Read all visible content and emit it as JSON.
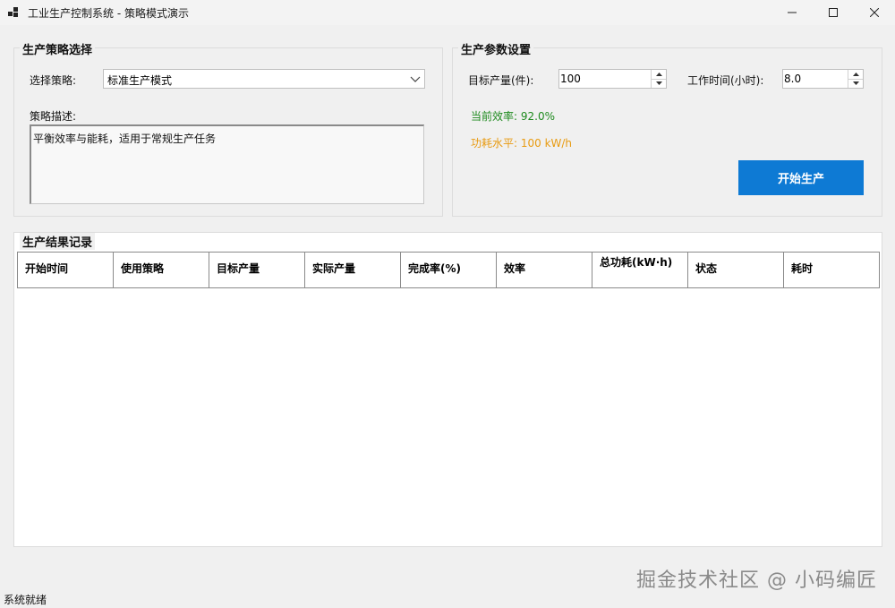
{
  "window": {
    "title": "工业生产控制系统 - 策略模式演示"
  },
  "strategy_group": {
    "title": "生产策略选择",
    "select_label": "选择策略:",
    "selected_strategy": "标准生产模式",
    "description_label": "策略描述:",
    "description": "平衡效率与能耗，适用于常规生产任务"
  },
  "params_group": {
    "title": "生产参数设置",
    "target_label": "目标产量(件):",
    "target_value": "100",
    "hours_label": "工作时间(小时):",
    "hours_value": "8.0",
    "efficiency_text": "当前效率: 92.0%",
    "power_text": "功耗水平: 100 kW/h",
    "start_button": "开始生产",
    "colors": {
      "efficiency": "#1e8a1e",
      "power": "#e89b12",
      "button": "#0e7ad4"
    }
  },
  "results_group": {
    "title": "生产结果记录",
    "columns": [
      "开始时间",
      "使用策略",
      "目标产量",
      "实际产量",
      "完成率(%)",
      "效率",
      "总功耗(kW·h)",
      "状态",
      "耗时"
    ],
    "rows": []
  },
  "status_bar": {
    "text": "系统就绪"
  },
  "watermark": "掘金技术社区 @ 小码编匠"
}
